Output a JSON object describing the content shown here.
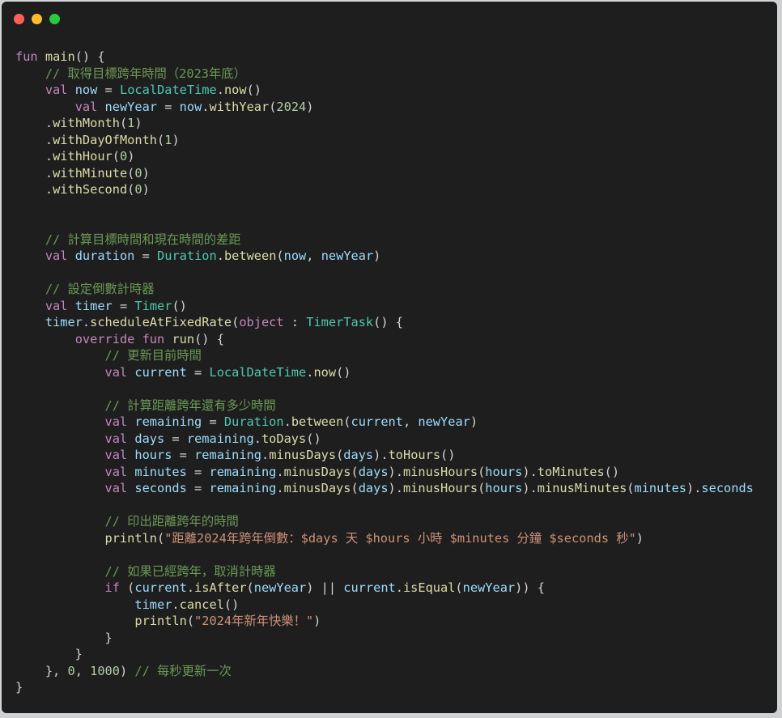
{
  "window": {
    "controls": [
      "close",
      "minimize",
      "maximize"
    ]
  },
  "editor": {
    "language": "kotlin",
    "lines": [
      [
        {
          "t": "fun",
          "c": "kw"
        },
        {
          "t": " "
        },
        {
          "t": "main",
          "c": "fn"
        },
        {
          "t": "() {"
        }
      ],
      [
        {
          "t": "    "
        },
        {
          "t": "// 取得目標跨年時間（2023年底）",
          "c": "cm"
        }
      ],
      [
        {
          "t": "    "
        },
        {
          "t": "val",
          "c": "kw"
        },
        {
          "t": " "
        },
        {
          "t": "now",
          "c": "id"
        },
        {
          "t": " = "
        },
        {
          "t": "LocalDateTime",
          "c": "ty"
        },
        {
          "t": "."
        },
        {
          "t": "now",
          "c": "fn"
        },
        {
          "t": "()"
        }
      ],
      [
        {
          "t": "        "
        },
        {
          "t": "val",
          "c": "kw"
        },
        {
          "t": " "
        },
        {
          "t": "newYear",
          "c": "id"
        },
        {
          "t": " = "
        },
        {
          "t": "now",
          "c": "id"
        },
        {
          "t": "."
        },
        {
          "t": "withYear",
          "c": "fn"
        },
        {
          "t": "("
        },
        {
          "t": "2024",
          "c": "num"
        },
        {
          "t": ")"
        }
      ],
      [
        {
          "t": "    ."
        },
        {
          "t": "withMonth",
          "c": "fn"
        },
        {
          "t": "("
        },
        {
          "t": "1",
          "c": "num"
        },
        {
          "t": ")"
        }
      ],
      [
        {
          "t": "    ."
        },
        {
          "t": "withDayOfMonth",
          "c": "fn"
        },
        {
          "t": "("
        },
        {
          "t": "1",
          "c": "num"
        },
        {
          "t": ")"
        }
      ],
      [
        {
          "t": "    ."
        },
        {
          "t": "withHour",
          "c": "fn"
        },
        {
          "t": "("
        },
        {
          "t": "0",
          "c": "num"
        },
        {
          "t": ")"
        }
      ],
      [
        {
          "t": "    ."
        },
        {
          "t": "withMinute",
          "c": "fn"
        },
        {
          "t": "("
        },
        {
          "t": "0",
          "c": "num"
        },
        {
          "t": ")"
        }
      ],
      [
        {
          "t": "    ."
        },
        {
          "t": "withSecond",
          "c": "fn"
        },
        {
          "t": "("
        },
        {
          "t": "0",
          "c": "num"
        },
        {
          "t": ")"
        }
      ],
      [],
      [],
      [
        {
          "t": "    "
        },
        {
          "t": "// 計算目標時間和現在時間的差距",
          "c": "cm"
        }
      ],
      [
        {
          "t": "    "
        },
        {
          "t": "val",
          "c": "kw"
        },
        {
          "t": " "
        },
        {
          "t": "duration",
          "c": "id"
        },
        {
          "t": " = "
        },
        {
          "t": "Duration",
          "c": "ty"
        },
        {
          "t": "."
        },
        {
          "t": "between",
          "c": "fn"
        },
        {
          "t": "("
        },
        {
          "t": "now",
          "c": "id"
        },
        {
          "t": ", "
        },
        {
          "t": "newYear",
          "c": "id"
        },
        {
          "t": ")"
        }
      ],
      [],
      [
        {
          "t": "    "
        },
        {
          "t": "// 設定倒數計時器",
          "c": "cm"
        }
      ],
      [
        {
          "t": "    "
        },
        {
          "t": "val",
          "c": "kw"
        },
        {
          "t": " "
        },
        {
          "t": "timer",
          "c": "id"
        },
        {
          "t": " = "
        },
        {
          "t": "Timer",
          "c": "ty"
        },
        {
          "t": "()"
        }
      ],
      [
        {
          "t": "    "
        },
        {
          "t": "timer",
          "c": "id"
        },
        {
          "t": "."
        },
        {
          "t": "scheduleAtFixedRate",
          "c": "fn"
        },
        {
          "t": "("
        },
        {
          "t": "object",
          "c": "kw"
        },
        {
          "t": " : "
        },
        {
          "t": "TimerTask",
          "c": "ty"
        },
        {
          "t": "() {"
        }
      ],
      [
        {
          "t": "        "
        },
        {
          "t": "override",
          "c": "kw"
        },
        {
          "t": " "
        },
        {
          "t": "fun",
          "c": "kw"
        },
        {
          "t": " "
        },
        {
          "t": "run",
          "c": "fn"
        },
        {
          "t": "() {"
        }
      ],
      [
        {
          "t": "            "
        },
        {
          "t": "// 更新目前時間",
          "c": "cm"
        }
      ],
      [
        {
          "t": "            "
        },
        {
          "t": "val",
          "c": "kw"
        },
        {
          "t": " "
        },
        {
          "t": "current",
          "c": "id"
        },
        {
          "t": " = "
        },
        {
          "t": "LocalDateTime",
          "c": "ty"
        },
        {
          "t": "."
        },
        {
          "t": "now",
          "c": "fn"
        },
        {
          "t": "()"
        }
      ],
      [],
      [
        {
          "t": "            "
        },
        {
          "t": "// 計算距離跨年還有多少時間",
          "c": "cm"
        }
      ],
      [
        {
          "t": "            "
        },
        {
          "t": "val",
          "c": "kw"
        },
        {
          "t": " "
        },
        {
          "t": "remaining",
          "c": "id"
        },
        {
          "t": " = "
        },
        {
          "t": "Duration",
          "c": "ty"
        },
        {
          "t": "."
        },
        {
          "t": "between",
          "c": "fn"
        },
        {
          "t": "("
        },
        {
          "t": "current",
          "c": "id"
        },
        {
          "t": ", "
        },
        {
          "t": "newYear",
          "c": "id"
        },
        {
          "t": ")"
        }
      ],
      [
        {
          "t": "            "
        },
        {
          "t": "val",
          "c": "kw"
        },
        {
          "t": " "
        },
        {
          "t": "days",
          "c": "id"
        },
        {
          "t": " = "
        },
        {
          "t": "remaining",
          "c": "id"
        },
        {
          "t": "."
        },
        {
          "t": "toDays",
          "c": "fn"
        },
        {
          "t": "()"
        }
      ],
      [
        {
          "t": "            "
        },
        {
          "t": "val",
          "c": "kw"
        },
        {
          "t": " "
        },
        {
          "t": "hours",
          "c": "id"
        },
        {
          "t": " = "
        },
        {
          "t": "remaining",
          "c": "id"
        },
        {
          "t": "."
        },
        {
          "t": "minusDays",
          "c": "fn"
        },
        {
          "t": "("
        },
        {
          "t": "days",
          "c": "id"
        },
        {
          "t": ")."
        },
        {
          "t": "toHours",
          "c": "fn"
        },
        {
          "t": "()"
        }
      ],
      [
        {
          "t": "            "
        },
        {
          "t": "val",
          "c": "kw"
        },
        {
          "t": " "
        },
        {
          "t": "minutes",
          "c": "id"
        },
        {
          "t": " = "
        },
        {
          "t": "remaining",
          "c": "id"
        },
        {
          "t": "."
        },
        {
          "t": "minusDays",
          "c": "fn"
        },
        {
          "t": "("
        },
        {
          "t": "days",
          "c": "id"
        },
        {
          "t": ")."
        },
        {
          "t": "minusHours",
          "c": "fn"
        },
        {
          "t": "("
        },
        {
          "t": "hours",
          "c": "id"
        },
        {
          "t": ")."
        },
        {
          "t": "toMinutes",
          "c": "fn"
        },
        {
          "t": "()"
        }
      ],
      [
        {
          "t": "            "
        },
        {
          "t": "val",
          "c": "kw"
        },
        {
          "t": " "
        },
        {
          "t": "seconds",
          "c": "id"
        },
        {
          "t": " = "
        },
        {
          "t": "remaining",
          "c": "id"
        },
        {
          "t": "."
        },
        {
          "t": "minusDays",
          "c": "fn"
        },
        {
          "t": "("
        },
        {
          "t": "days",
          "c": "id"
        },
        {
          "t": ")."
        },
        {
          "t": "minusHours",
          "c": "fn"
        },
        {
          "t": "("
        },
        {
          "t": "hours",
          "c": "id"
        },
        {
          "t": ")."
        },
        {
          "t": "minusMinutes",
          "c": "fn"
        },
        {
          "t": "("
        },
        {
          "t": "minutes",
          "c": "id"
        },
        {
          "t": ")."
        },
        {
          "t": "seconds",
          "c": "id"
        }
      ],
      [],
      [
        {
          "t": "            "
        },
        {
          "t": "// 印出距離跨年的時間",
          "c": "cm"
        }
      ],
      [
        {
          "t": "            "
        },
        {
          "t": "println",
          "c": "fn"
        },
        {
          "t": "("
        },
        {
          "t": "\"距離2024年跨年倒數：$days 天 $hours 小時 $minutes 分鐘 $seconds 秒\"",
          "c": "str"
        },
        {
          "t": ")"
        }
      ],
      [],
      [
        {
          "t": "            "
        },
        {
          "t": "// 如果已經跨年，取消計時器",
          "c": "cm"
        }
      ],
      [
        {
          "t": "            "
        },
        {
          "t": "if",
          "c": "kw"
        },
        {
          "t": " ("
        },
        {
          "t": "current",
          "c": "id"
        },
        {
          "t": "."
        },
        {
          "t": "isAfter",
          "c": "fn"
        },
        {
          "t": "("
        },
        {
          "t": "newYear",
          "c": "id"
        },
        {
          "t": ") || "
        },
        {
          "t": "current",
          "c": "id"
        },
        {
          "t": "."
        },
        {
          "t": "isEqual",
          "c": "fn"
        },
        {
          "t": "("
        },
        {
          "t": "newYear",
          "c": "id"
        },
        {
          "t": ")) {"
        }
      ],
      [
        {
          "t": "                "
        },
        {
          "t": "timer",
          "c": "id"
        },
        {
          "t": "."
        },
        {
          "t": "cancel",
          "c": "fn"
        },
        {
          "t": "()"
        }
      ],
      [
        {
          "t": "                "
        },
        {
          "t": "println",
          "c": "fn"
        },
        {
          "t": "("
        },
        {
          "t": "\"2024年新年快樂！\"",
          "c": "str"
        },
        {
          "t": ")"
        }
      ],
      [
        {
          "t": "            }"
        }
      ],
      [
        {
          "t": "        }"
        }
      ],
      [
        {
          "t": "    }, "
        },
        {
          "t": "0",
          "c": "num"
        },
        {
          "t": ", "
        },
        {
          "t": "1000",
          "c": "num"
        },
        {
          "t": ") "
        },
        {
          "t": "// 每秒更新一次",
          "c": "cm"
        }
      ],
      [
        {
          "t": "}"
        }
      ]
    ]
  }
}
